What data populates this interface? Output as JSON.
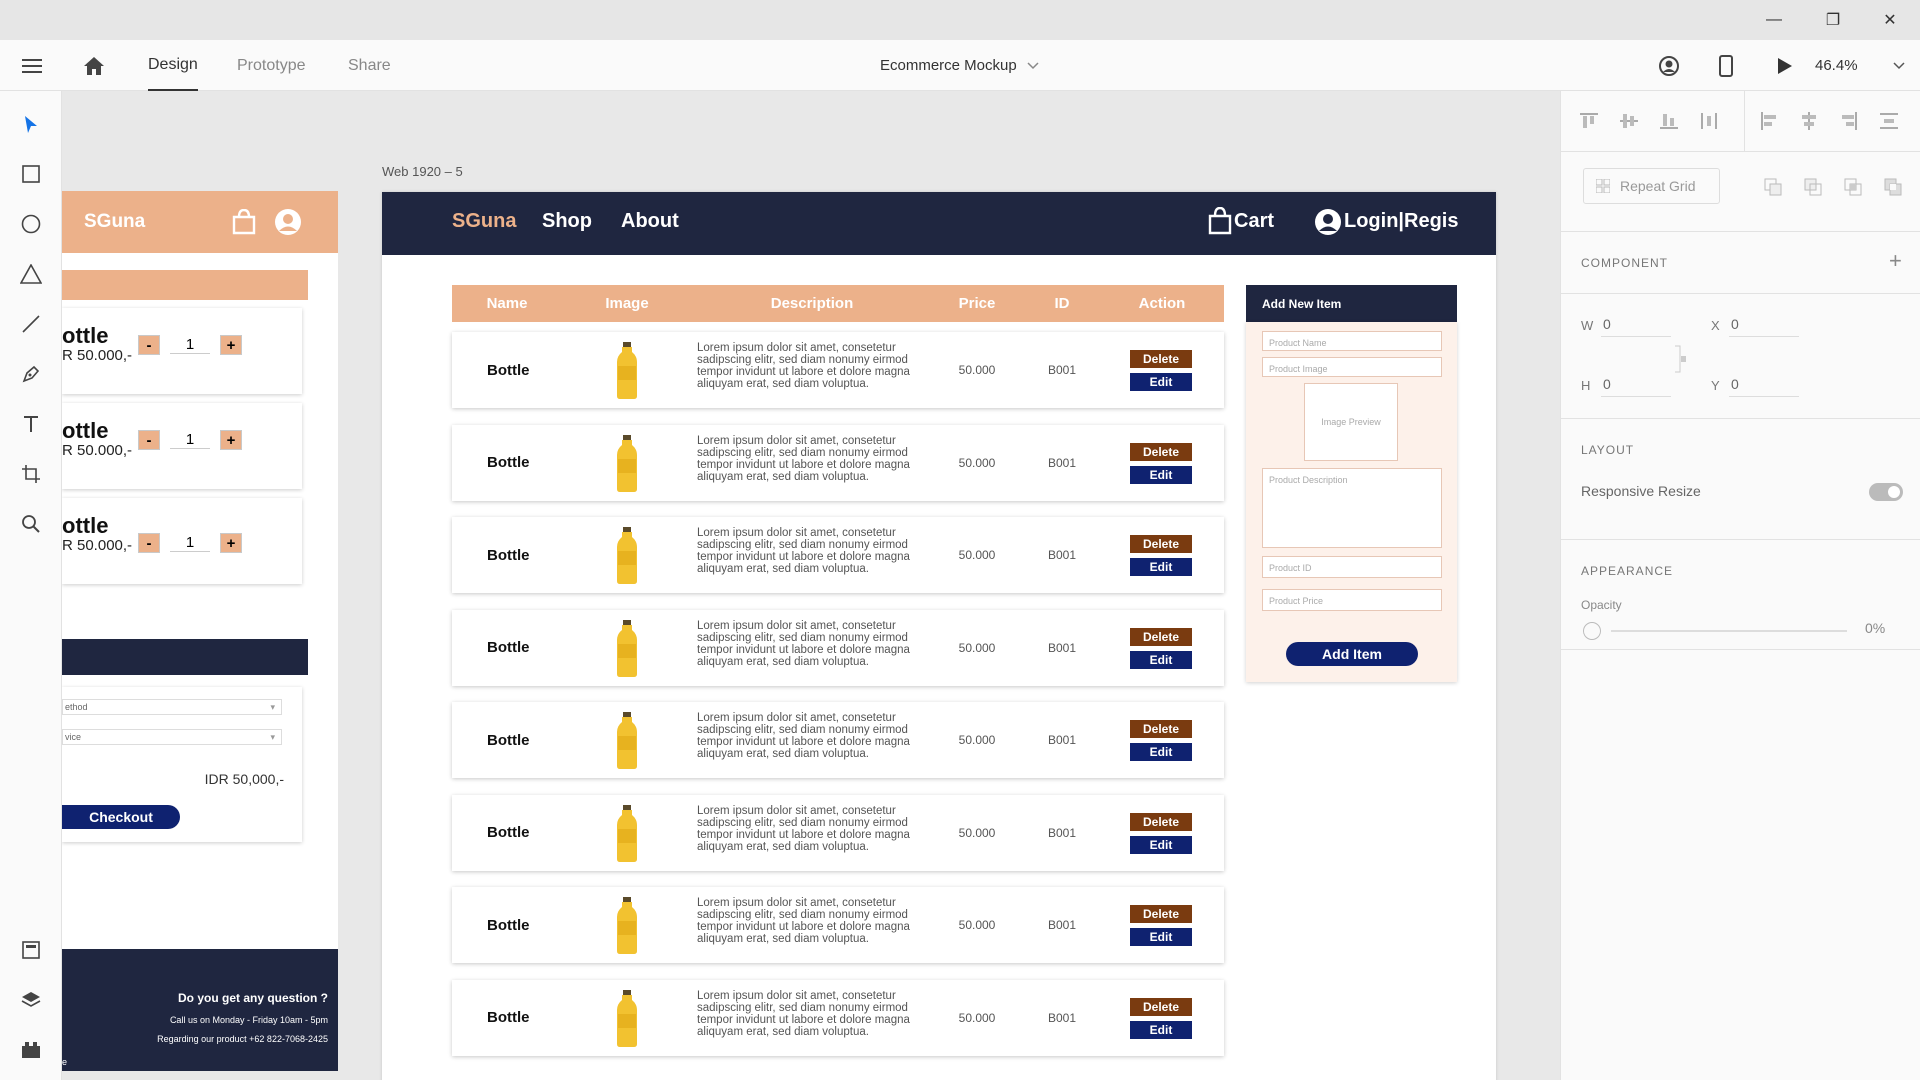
{
  "window": {
    "minimize": "—",
    "restore": "❐",
    "close": "✕"
  },
  "header": {
    "tabs": [
      {
        "label": "Design",
        "active": true
      },
      {
        "label": "Prototype",
        "active": false
      },
      {
        "label": "Share",
        "active": false
      }
    ],
    "document_title": "Ecommerce Mockup",
    "zoom": "46.4%"
  },
  "canvas": {
    "artboard_label": "Web 1920 – 5",
    "left_frame": {
      "brand": "SGuna",
      "cart_items": [
        {
          "name": "ottle",
          "price": "R 50.000,-",
          "qty": "1"
        },
        {
          "name": "ottle",
          "price": "R 50.000,-",
          "qty": "1"
        },
        {
          "name": "ottle",
          "price": "R 50.000,-",
          "qty": "1"
        }
      ],
      "minus": "-",
      "plus": "+",
      "payment_method": "ethod",
      "service": "vice",
      "total": "IDR 50,000,-",
      "checkout": "Checkout",
      "footer": {
        "question": "Do you get any question ?",
        "line1": "Call us on Monday - Friday 10am - 5pm",
        "line2": "Regarding our product +62 822-7068-2425",
        "partial": "e"
      }
    },
    "main_frame": {
      "nav": {
        "brand": "SGuna",
        "shop": "Shop",
        "about": "About",
        "cart": "Cart",
        "login": "Login|Regis"
      },
      "table": {
        "headers": [
          "Name",
          "Image",
          "Description",
          "Price",
          "ID",
          "Action"
        ],
        "rows": [
          {
            "name": "Bottle",
            "desc": "Lorem ipsum dolor sit amet, consetetur sadipscing elitr, sed diam nonumy eirmod tempor invidunt ut labore et dolore magna aliquyam erat, sed diam voluptua.",
            "price": "50.000",
            "id": "B001",
            "delete": "Delete",
            "edit": "Edit"
          },
          {
            "name": "Bottle",
            "desc": "Lorem ipsum dolor sit amet, consetetur sadipscing elitr, sed diam nonumy eirmod tempor invidunt ut labore et dolore magna aliquyam erat, sed diam voluptua.",
            "price": "50.000",
            "id": "B001",
            "delete": "Delete",
            "edit": "Edit"
          },
          {
            "name": "Bottle",
            "desc": "Lorem ipsum dolor sit amet, consetetur sadipscing elitr, sed diam nonumy eirmod tempor invidunt ut labore et dolore magna aliquyam erat, sed diam voluptua.",
            "price": "50.000",
            "id": "B001",
            "delete": "Delete",
            "edit": "Edit"
          },
          {
            "name": "Bottle",
            "desc": "Lorem ipsum dolor sit amet, consetetur sadipscing elitr, sed diam nonumy eirmod tempor invidunt ut labore et dolore magna aliquyam erat, sed diam voluptua.",
            "price": "50.000",
            "id": "B001",
            "delete": "Delete",
            "edit": "Edit"
          },
          {
            "name": "Bottle",
            "desc": "Lorem ipsum dolor sit amet, consetetur sadipscing elitr, sed diam nonumy eirmod tempor invidunt ut labore et dolore magna aliquyam erat, sed diam voluptua.",
            "price": "50.000",
            "id": "B001",
            "delete": "Delete",
            "edit": "Edit"
          },
          {
            "name": "Bottle",
            "desc": "Lorem ipsum dolor sit amet, consetetur sadipscing elitr, sed diam nonumy eirmod tempor invidunt ut labore et dolore magna aliquyam erat, sed diam voluptua.",
            "price": "50.000",
            "id": "B001",
            "delete": "Delete",
            "edit": "Edit"
          },
          {
            "name": "Bottle",
            "desc": "Lorem ipsum dolor sit amet, consetetur sadipscing elitr, sed diam nonumy eirmod tempor invidunt ut labore et dolore magna aliquyam erat, sed diam voluptua.",
            "price": "50.000",
            "id": "B001",
            "delete": "Delete",
            "edit": "Edit"
          },
          {
            "name": "Bottle",
            "desc": "Lorem ipsum dolor sit amet, consetetur sadipscing elitr, sed diam nonumy eirmod tempor invidunt ut labore et dolore magna aliquyam erat, sed diam voluptua.",
            "price": "50.000",
            "id": "B001",
            "delete": "Delete",
            "edit": "Edit"
          }
        ]
      },
      "add_form": {
        "title": "Add New Item",
        "product_name": "Product Name",
        "product_image": "Product Image",
        "image_preview": "Image Preview",
        "product_description": "Product Description",
        "product_id": "Product ID",
        "product_price": "Product Price",
        "button": "Add Item"
      }
    }
  },
  "right_panel": {
    "repeat_grid": "Repeat Grid",
    "component_label": "COMPONENT",
    "w_label": "W",
    "w_value": "0",
    "h_label": "H",
    "h_value": "0",
    "x_label": "X",
    "x_value": "0",
    "y_label": "Y",
    "y_value": "0",
    "layout_label": "LAYOUT",
    "responsive_resize": "Responsive Resize",
    "appearance_label": "APPEARANCE",
    "opacity_label": "Opacity",
    "opacity_value": "0%"
  },
  "colors": {
    "navy": "#1f2640",
    "peach": "#ecb18a",
    "delete": "#7a3b10",
    "edit": "#0f2270",
    "accent": "#1473e6"
  }
}
